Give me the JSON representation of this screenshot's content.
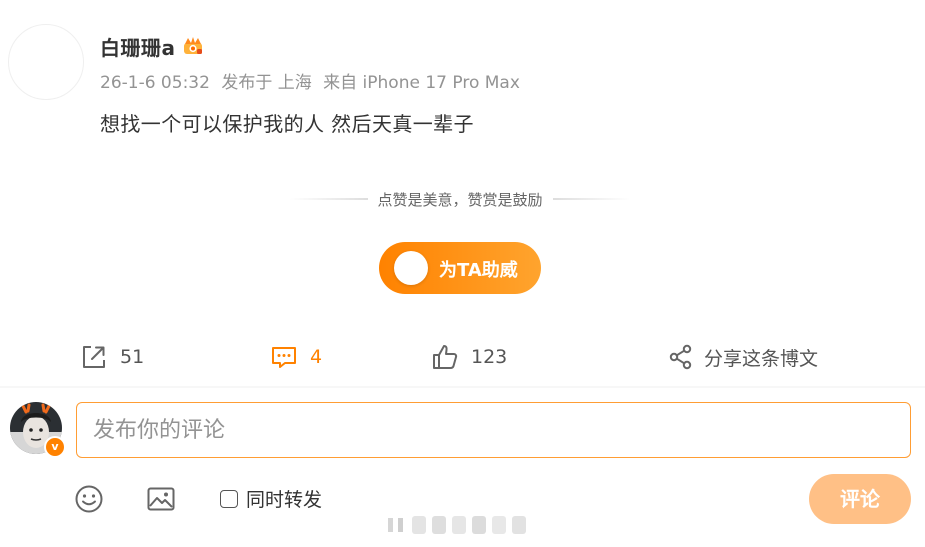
{
  "post": {
    "author_name": "白珊珊a",
    "author_badge_icon": "crown-badge-icon",
    "timestamp": "26-1-6 05:32",
    "location": "发布于 上海",
    "source": "来自 iPhone 17 Pro Max",
    "text": "想找一个可以保护我的人 然后天真一辈子"
  },
  "reward": {
    "hint": "点赞是美意，赞赏是鼓励",
    "button_label": "为TA助威"
  },
  "actions": {
    "repost_count": "51",
    "comment_count": "4",
    "like_count": "123",
    "share_label": "分享这条博文"
  },
  "composer": {
    "placeholder": "发布你的评论",
    "repost_label": "同时转发",
    "submit_label": "评论",
    "badge_letter": "v"
  },
  "colors": {
    "accent": "#ff8200",
    "submit_disabled": "#ffc086",
    "meta_text": "#939393"
  }
}
